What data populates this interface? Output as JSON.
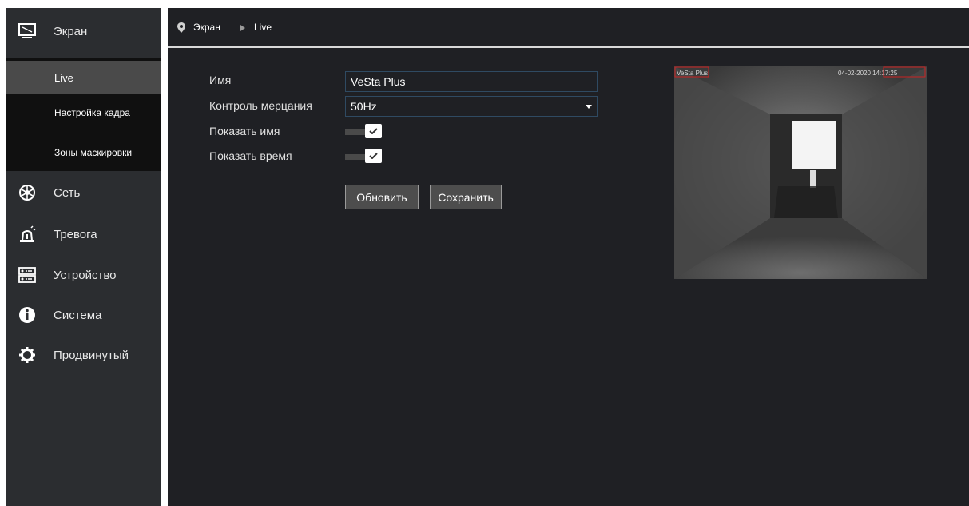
{
  "sidebar": {
    "items": [
      {
        "label": "Экран",
        "icon": "monitor-icon"
      },
      {
        "label": "Сеть",
        "icon": "network-icon"
      },
      {
        "label": "Тревога",
        "icon": "alarm-icon"
      },
      {
        "label": "Устройство",
        "icon": "device-icon"
      },
      {
        "label": "Система",
        "icon": "info-icon"
      },
      {
        "label": "Продвинутый",
        "icon": "gear-icon"
      }
    ],
    "submenu": [
      {
        "label": "Live"
      },
      {
        "label": "Настройка кадра"
      },
      {
        "label": "Зоны маскировки"
      }
    ]
  },
  "breadcrumb": {
    "section": "Экран",
    "page": "Live"
  },
  "form": {
    "name_label": "Имя",
    "name_value": "VeSta Plus",
    "flicker_label": "Контроль мерцания",
    "flicker_value": "50Hz",
    "show_name_label": "Показать имя",
    "show_name_on": true,
    "show_time_label": "Показать время",
    "show_time_on": true
  },
  "buttons": {
    "refresh": "Обновить",
    "save": "Сохранить"
  },
  "preview": {
    "name_overlay": "VeSta Plus",
    "time_overlay": "04-02-2020 14:17:25"
  },
  "colors": {
    "sidebar_bg": "#2b2d30",
    "main_bg": "#1f2024",
    "active_item": "#4a4a4a",
    "field_border": "#2f4a62"
  }
}
